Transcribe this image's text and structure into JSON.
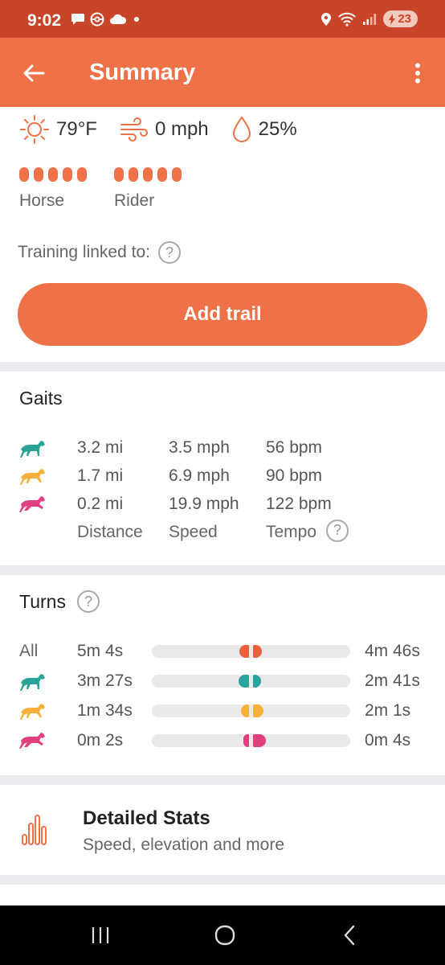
{
  "status_bar": {
    "time": "9:02",
    "battery": "23"
  },
  "app_bar": {
    "title": "Summary"
  },
  "weather": {
    "temperature": "79°F",
    "wind": "0 mph",
    "humidity": "25%"
  },
  "ratings": {
    "horse": {
      "label": "Horse",
      "value": 5,
      "max": 5
    },
    "rider": {
      "label": "Rider",
      "value": 5,
      "max": 5
    }
  },
  "training": {
    "label": "Training linked to:",
    "help": "?",
    "button": "Add trail"
  },
  "gaits": {
    "title": "Gaits",
    "rows": [
      {
        "color": "#2aa39a",
        "distance": "3.2 mi",
        "speed": "3.5 mph",
        "tempo": "56 bpm"
      },
      {
        "color": "#f6b13a",
        "distance": "1.7 mi",
        "speed": "6.9 mph",
        "tempo": "90 bpm"
      },
      {
        "color": "#e0407f",
        "distance": "0.2 mi",
        "speed": "19.9 mph",
        "tempo": "122 bpm"
      }
    ],
    "headers": {
      "distance": "Distance",
      "speed": "Speed",
      "tempo": "Tempo"
    },
    "help": "?"
  },
  "turns": {
    "title": "Turns",
    "help": "?",
    "rows": [
      {
        "label": "All",
        "left": "5m 4s",
        "right": "4m 46s",
        "color": "#e8603a",
        "left_frac": 0.52,
        "right_frac": 0.48
      },
      {
        "label": "",
        "left": "3m 27s",
        "right": "2m 41s",
        "color": "#2aa39a",
        "left_frac": 0.56,
        "right_frac": 0.44
      },
      {
        "label": "",
        "left": "1m 34s",
        "right": "2m 1s",
        "color": "#f6b13a",
        "left_frac": 0.44,
        "right_frac": 0.56
      },
      {
        "label": "",
        "left": "0m 2s",
        "right": "0m 4s",
        "color": "#e0407f",
        "left_frac": 0.33,
        "right_frac": 0.67
      }
    ]
  },
  "detailed_stats": {
    "title": "Detailed Stats",
    "subtitle": "Speed, elevation and more"
  },
  "colors": {
    "accent": "#ee7147",
    "status_bar": "#c8452a"
  }
}
